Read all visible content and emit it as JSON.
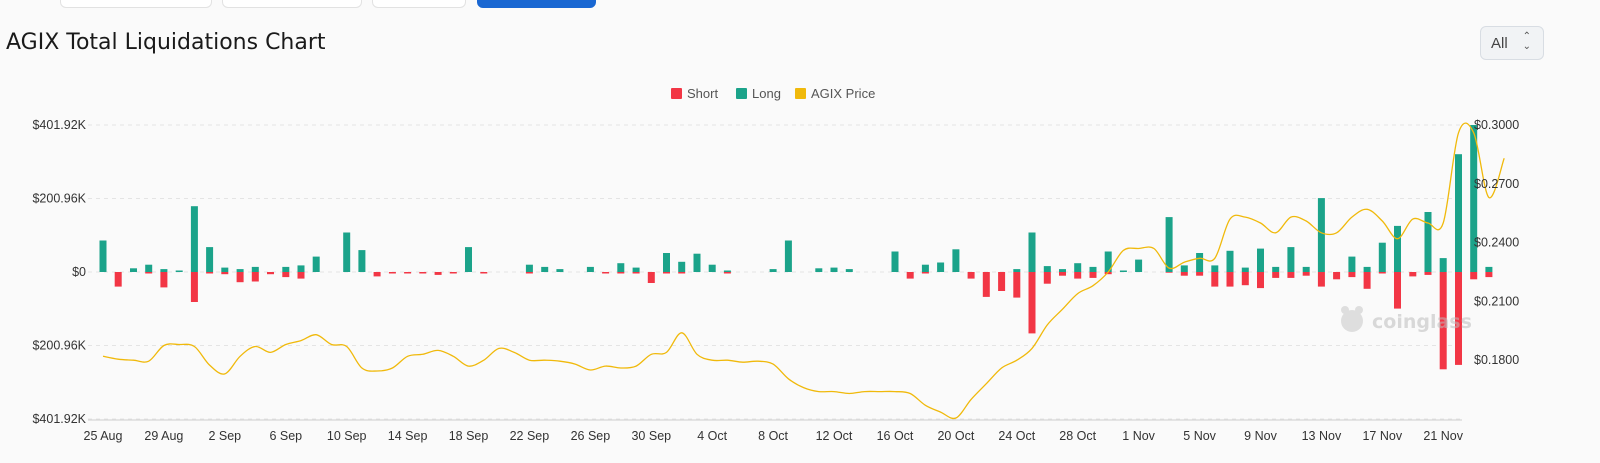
{
  "title": "AGIX Total Liquidations Chart",
  "range_select": {
    "value": "All"
  },
  "watermark": "coinglass",
  "colors": {
    "short": "#f23645",
    "long": "#1ba38a",
    "price": "#f0b90b",
    "grid": "#e4e4e4"
  },
  "chart_data": {
    "type": "bar",
    "legend": [
      {
        "key": "short",
        "label": "Short"
      },
      {
        "key": "long",
        "label": "Long"
      },
      {
        "key": "price",
        "label": "AGIX Price"
      }
    ],
    "legend_position": "top-center",
    "x": [
      "25 Aug",
      "26 Aug",
      "27 Aug",
      "28 Aug",
      "29 Aug",
      "30 Aug",
      "31 Aug",
      "1 Sep",
      "2 Sep",
      "3 Sep",
      "4 Sep",
      "5 Sep",
      "6 Sep",
      "7 Sep",
      "8 Sep",
      "9 Sep",
      "10 Sep",
      "11 Sep",
      "12 Sep",
      "13 Sep",
      "14 Sep",
      "15 Sep",
      "16 Sep",
      "17 Sep",
      "18 Sep",
      "19 Sep",
      "20 Sep",
      "21 Sep",
      "22 Sep",
      "23 Sep",
      "24 Sep",
      "25 Sep",
      "26 Sep",
      "27 Sep",
      "28 Sep",
      "29 Sep",
      "30 Sep",
      "1 Oct",
      "2 Oct",
      "3 Oct",
      "4 Oct",
      "5 Oct",
      "6 Oct",
      "7 Oct",
      "8 Oct",
      "9 Oct",
      "10 Oct",
      "11 Oct",
      "12 Oct",
      "13 Oct",
      "14 Oct",
      "15 Oct",
      "16 Oct",
      "17 Oct",
      "18 Oct",
      "19 Oct",
      "20 Oct",
      "21 Oct",
      "22 Oct",
      "23 Oct",
      "24 Oct",
      "25 Oct",
      "26 Oct",
      "27 Oct",
      "28 Oct",
      "29 Oct",
      "30 Oct",
      "31 Oct",
      "1 Nov",
      "2 Nov",
      "3 Nov",
      "4 Nov",
      "5 Nov",
      "6 Nov",
      "7 Nov",
      "8 Nov",
      "9 Nov",
      "10 Nov",
      "11 Nov",
      "12 Nov",
      "13 Nov",
      "14 Nov",
      "15 Nov",
      "16 Nov",
      "17 Nov",
      "18 Nov",
      "19 Nov",
      "20 Nov",
      "21 Nov",
      "22 Nov"
    ],
    "x_tick_labels": [
      "25 Aug",
      "29 Aug",
      "2 Sep",
      "6 Sep",
      "10 Sep",
      "14 Sep",
      "18 Sep",
      "22 Sep",
      "26 Sep",
      "30 Sep",
      "4 Oct",
      "8 Oct",
      "12 Oct",
      "16 Oct",
      "20 Oct",
      "24 Oct",
      "28 Oct",
      "1 Nov",
      "5 Nov",
      "9 Nov",
      "13 Nov",
      "17 Nov",
      "21 Nov"
    ],
    "series": [
      {
        "name": "Long",
        "unit": "USD",
        "values": [
          86000,
          0,
          10000,
          20000,
          8000,
          4000,
          180000,
          68000,
          12000,
          8000,
          14000,
          0,
          14000,
          18000,
          42000,
          0,
          108000,
          60000,
          0,
          0,
          0,
          0,
          0,
          0,
          68000,
          0,
          0,
          0,
          20000,
          14000,
          8000,
          0,
          14000,
          0,
          24000,
          12000,
          0,
          52000,
          28000,
          50000,
          20000,
          4000,
          0,
          0,
          8000,
          86000,
          0,
          10000,
          12000,
          8000,
          0,
          0,
          56000,
          0,
          20000,
          26000,
          62000,
          0,
          0,
          0,
          8000,
          108000,
          16000,
          8000,
          24000,
          14000,
          56000,
          4000,
          34000,
          0,
          150000,
          18000,
          52000,
          18000,
          58000,
          12000,
          64000,
          14000,
          68000,
          14000,
          202000,
          0,
          42000,
          14000,
          80000,
          126000,
          0,
          164000,
          38000,
          322000,
          401920,
          14000
        ]
      },
      {
        "name": "Short",
        "unit": "USD",
        "values": [
          0,
          -40000,
          0,
          -4000,
          -42000,
          0,
          -82000,
          -4000,
          -6000,
          -28000,
          -26000,
          -6000,
          -14000,
          -18000,
          0,
          0,
          0,
          0,
          -12000,
          -4000,
          -4000,
          -4000,
          -8000,
          -4000,
          0,
          -4000,
          0,
          0,
          -4000,
          0,
          0,
          0,
          0,
          -4000,
          -4000,
          -4000,
          -30000,
          -4000,
          -4000,
          0,
          0,
          -4000,
          0,
          0,
          0,
          0,
          0,
          0,
          0,
          0,
          0,
          0,
          0,
          -18000,
          -4000,
          0,
          0,
          -18000,
          -68000,
          -52000,
          -70000,
          -168000,
          -32000,
          -10000,
          -18000,
          -16000,
          -6000,
          0,
          0,
          0,
          -2000,
          -10000,
          -10000,
          -40000,
          -40000,
          -36000,
          -44000,
          -16000,
          -16000,
          -10000,
          -40000,
          -20000,
          -14000,
          -46000,
          -4000,
          -100000,
          -12000,
          -8000,
          -266000,
          -254000,
          -20000,
          -14000
        ]
      },
      {
        "name": "AGIX Price",
        "unit": "USD",
        "axis": "right",
        "values": [
          0.182,
          0.1805,
          0.18,
          0.1795,
          0.1875,
          0.188,
          0.187,
          0.1775,
          0.173,
          0.182,
          0.187,
          0.184,
          0.188,
          0.19,
          0.193,
          0.188,
          0.187,
          0.176,
          0.1745,
          0.176,
          0.182,
          0.183,
          0.185,
          0.182,
          0.177,
          0.18,
          0.186,
          0.184,
          0.18,
          0.18,
          0.1795,
          0.178,
          0.175,
          0.177,
          0.176,
          0.177,
          0.183,
          0.184,
          0.194,
          0.183,
          0.18,
          0.18,
          0.179,
          0.1795,
          0.178,
          0.1705,
          0.166,
          0.164,
          0.164,
          0.163,
          0.164,
          0.164,
          0.164,
          0.163,
          0.157,
          0.1535,
          0.1505,
          0.16,
          0.168,
          0.176,
          0.18,
          0.186,
          0.198,
          0.206,
          0.214,
          0.218,
          0.225,
          0.236,
          0.237,
          0.237,
          0.227,
          0.23,
          0.232,
          0.232,
          0.252,
          0.253,
          0.25,
          0.245,
          0.253,
          0.251,
          0.245,
          0.245,
          0.253,
          0.257,
          0.251,
          0.242,
          0.252,
          0.25,
          0.25,
          0.296,
          0.296,
          0.263,
          0.283
        ]
      }
    ],
    "y_left": {
      "ticks": [
        "$401.92K",
        "$200.96K",
        "$0",
        "$200.96K",
        "$401.92K"
      ],
      "range": [
        -401920,
        401920
      ]
    },
    "y_right": {
      "ticks": [
        "$0.3000",
        "$0.2700",
        "$0.2400",
        "$0.2100",
        "$0.1800"
      ],
      "range": [
        0.15,
        0.3
      ]
    },
    "grid": true
  }
}
